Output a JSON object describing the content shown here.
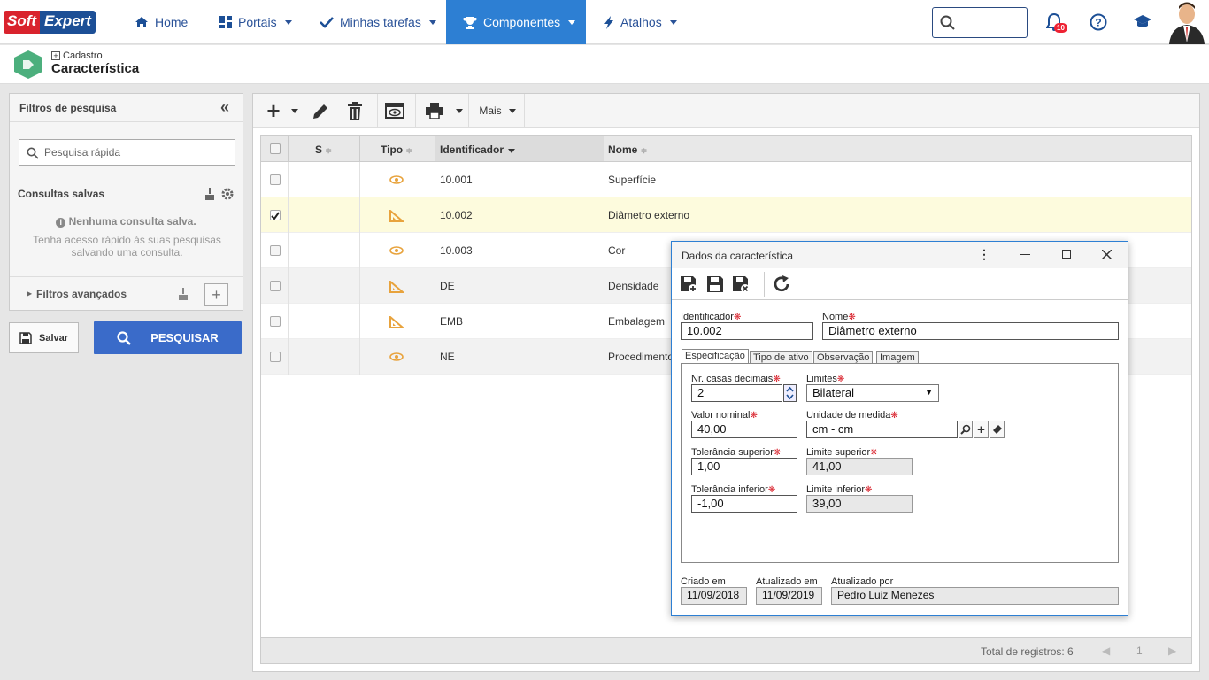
{
  "header": {
    "logo_soft": "Soft",
    "logo_expert": "Expert",
    "nav": [
      {
        "label": "Home"
      },
      {
        "label": "Portais"
      },
      {
        "label": "Minhas tarefas"
      },
      {
        "label": "Componentes"
      },
      {
        "label": "Atalhos"
      }
    ],
    "notifications": "10"
  },
  "page": {
    "breadcrumb": "Cadastro",
    "title": "Característica"
  },
  "filters": {
    "title": "Filtros de pesquisa",
    "quick_placeholder": "Pesquisa rápida",
    "saved_title": "Consultas salvas",
    "no_saved": "Nenhuma consulta salva.",
    "hint": "Tenha acesso rápido às suas pesquisas salvando uma consulta.",
    "advanced": "Filtros avançados",
    "save_label": "Salvar",
    "search_label": "PESQUISAR"
  },
  "toolbar": {
    "more": "Mais"
  },
  "grid": {
    "columns": {
      "s": "S",
      "tipo": "Tipo",
      "id": "Identificador",
      "nome": "Nome"
    },
    "rows": [
      {
        "id": "10.001",
        "nome": "Superfície",
        "icon": "eye-icon",
        "checked": false
      },
      {
        "id": "10.002",
        "nome": "Diâmetro externo",
        "icon": "ruler-icon",
        "checked": true
      },
      {
        "id": "10.003",
        "nome": "Cor",
        "icon": "eye-icon",
        "checked": false
      },
      {
        "id": "DE",
        "nome": "Densidade",
        "icon": "ruler-icon",
        "checked": false
      },
      {
        "id": "EMB",
        "nome": "Embalagem",
        "icon": "ruler-icon",
        "checked": false
      },
      {
        "id": "NE",
        "nome": "Procedimento",
        "icon": "eye-icon",
        "checked": false
      }
    ],
    "total": "Total de registros: 6",
    "page": "1"
  },
  "dialog": {
    "title": "Dados da característica",
    "id_label": "Identificador",
    "id_value": "10.002",
    "nome_label": "Nome",
    "nome_value": "Diâmetro externo",
    "tabs": [
      "Especificação",
      "Tipo de ativo",
      "Observação",
      "Imagem"
    ],
    "casas_label": "Nr. casas decimais",
    "casas_value": "2",
    "limites_label": "Limites",
    "limites_value": "Bilateral",
    "nominal_label": "Valor nominal",
    "nominal_value": "40,00",
    "unidade_label": "Unidade de medida",
    "unidade_value": "cm - cm",
    "tol_sup_label": "Tolerância superior",
    "tol_sup_value": "1,00",
    "lim_sup_label": "Limite superior",
    "lim_sup_value": "41,00",
    "tol_inf_label": "Tolerância inferior",
    "tol_inf_value": "-1,00",
    "lim_inf_label": "Limite inferior",
    "lim_inf_value": "39,00",
    "criado_label": "Criado em",
    "criado_value": "11/09/2018",
    "atual_label": "Atualizado em",
    "atual_value": "11/09/2019",
    "atualpor_label": "Atualizado por",
    "atualpor_value": "Pedro Luiz Menezes"
  },
  "colors": {
    "accent": "#2d7fd3",
    "selected_row": "#fdfbdd",
    "required": "#d9232d",
    "icon": "#e8a33d"
  }
}
